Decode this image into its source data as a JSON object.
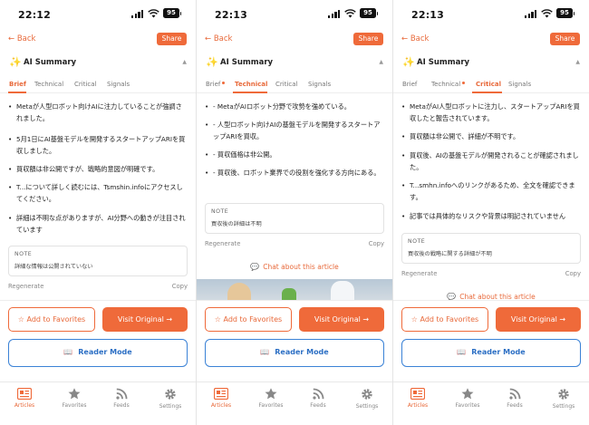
{
  "status": {
    "battery": "95"
  },
  "nav": {
    "back_label": "← Back",
    "share_label": "Share"
  },
  "summary": {
    "sparkle": "✨",
    "title": "AI Summary",
    "caret": "▲"
  },
  "tabs": [
    "Brief",
    "Technical",
    "Critical",
    "Signals"
  ],
  "actions": {
    "favorites_label": "☆ Add to Favorites",
    "visit_label": "Visit Original →",
    "reader_label": "Reader Mode"
  },
  "tabbar": [
    "Articles",
    "Favorites",
    "Feeds",
    "Settings"
  ],
  "common": {
    "regenerate": "Regenerate",
    "copy": "Copy",
    "note_label": "NOTE",
    "chat_label": "Chat about this article"
  },
  "colors": {
    "accent": "#ef6a3a",
    "reader_blue": "#3b82d6"
  },
  "screens": [
    {
      "time": "22:12",
      "active_tab": "Brief",
      "bullets": [
        "Metaが人型ロボット向けAIに注力していることが強調されました。",
        "5月1日にAI基盤モデルを開発するスタートアップARIを買収しました。",
        "買収額は非公開ですが、戦略的意図が明確です。",
        "T...について詳しく読むには、Tsmshin.infoにアクセスしてください。",
        "詳細は不明な点がありますが、AI分野への動きが注目されています"
      ],
      "note": "詳細な情報は公開されていない"
    },
    {
      "time": "22:13",
      "active_tab": "Technical",
      "bullets": [
        "- MetaがAIロボット分野で攻勢を強めている。",
        "- 人型ロボット向けAIの基盤モデルを開発するスタートアップARIを買収。",
        "- 買収価格は非公開。",
        "- 買収後、ロボット業界での役割を強化する方向にある。"
      ],
      "note": "買収後の詳細は不明"
    },
    {
      "time": "22:13",
      "active_tab": "Critical",
      "bullets": [
        "MetaがAI人型ロボットに注力し、スタートアップARIを買収したと報告されています。",
        "買収額は非公開で、詳細が不明です。",
        "買収後、AIの基盤モデルが開発されることが確認されました。",
        "T...smhn.infoへのリンクがあるため、全文を確認できます。",
        "記事では具体的なリスクや背景は明記されていません"
      ],
      "note": "買収後の戦略に関する詳細が不明"
    }
  ]
}
